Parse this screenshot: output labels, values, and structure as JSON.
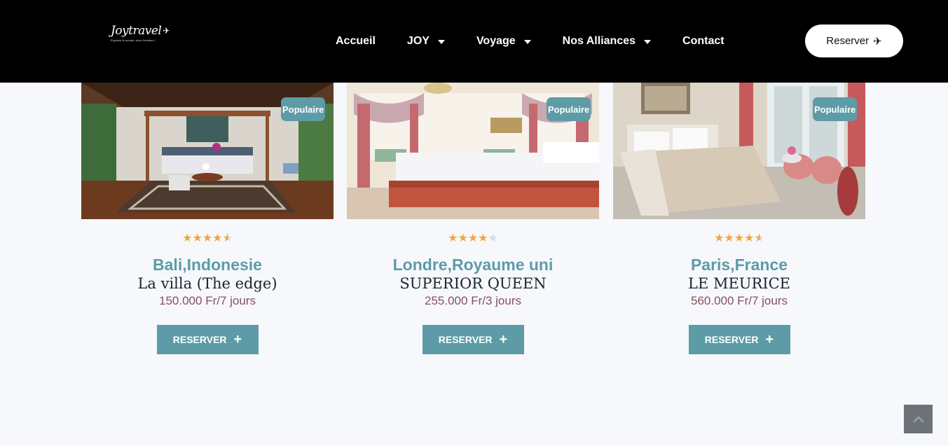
{
  "header": {
    "logo": {
      "brand": "Joytravel",
      "tagline": "Explorez le monde, vivez l'émotion !"
    },
    "nav": [
      {
        "label": "Accueil",
        "dropdown": false
      },
      {
        "label": "JOY",
        "dropdown": true
      },
      {
        "label": "Voyage",
        "dropdown": true
      },
      {
        "label": "Nos Alliances",
        "dropdown": true
      },
      {
        "label": "Contact",
        "dropdown": false
      }
    ],
    "reserve_label": "Reserver"
  },
  "cards": [
    {
      "badge": "Populaire",
      "rating": 4.5,
      "city": "Bali,Indonesie",
      "hotel": "La villa (The edge)",
      "price": "150.000 Fr/7 jours",
      "cta": "RESERVER"
    },
    {
      "badge": "Populaire",
      "rating": 4,
      "city": "Londre,Royaume uni",
      "hotel": "SUPERIOR QUEEN",
      "price": "255.000 Fr/3 jours",
      "cta": "RESERVER"
    },
    {
      "badge": "Populaire",
      "rating": 4.5,
      "city": "Paris,France",
      "hotel": "LE MEURICE",
      "price": "560.000 Fr/7 jours",
      "cta": "RESERVER"
    }
  ],
  "colors": {
    "accent": "#5d9ca6",
    "price": "#8a4f60",
    "header": "#000000",
    "star": "#f1a83a"
  }
}
